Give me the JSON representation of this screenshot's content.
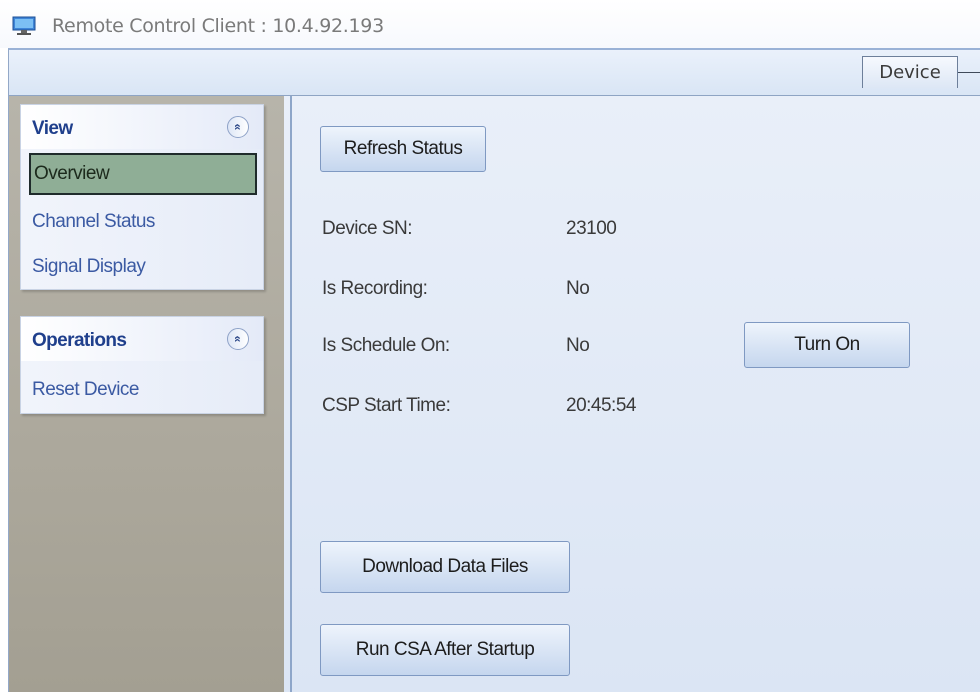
{
  "window": {
    "title": "Remote Control Client : 10.4.92.193"
  },
  "tabs": {
    "active_label": "Device"
  },
  "sidebar": {
    "view_panel": {
      "title": "View",
      "items": [
        "Overview",
        "Channel Status",
        "Signal Display"
      ],
      "selected": "Overview"
    },
    "operations_panel": {
      "title": "Operations",
      "items": [
        "Reset Device"
      ]
    },
    "collapse_glyph": "«"
  },
  "main": {
    "refresh_button": "Refresh Status",
    "fields": [
      {
        "label": "Device SN:",
        "value": "23100"
      },
      {
        "label": "Is Recording:",
        "value": "No"
      },
      {
        "label": "Is Schedule On:",
        "value": "No"
      },
      {
        "label": "CSP Start Time:",
        "value": "20:45:54"
      }
    ],
    "turn_on_button": "Turn On",
    "download_button": "Download Data Files",
    "run_csa_button": "Run CSA After Startup"
  },
  "colors": {
    "accent": "#1f3f8c",
    "link": "#3b5aa3",
    "selection": "#8fae96",
    "sidebar_bg": "#aca89c"
  },
  "icons": {
    "app": "monitor-icon",
    "collapse": "chevron-double-up-icon"
  }
}
